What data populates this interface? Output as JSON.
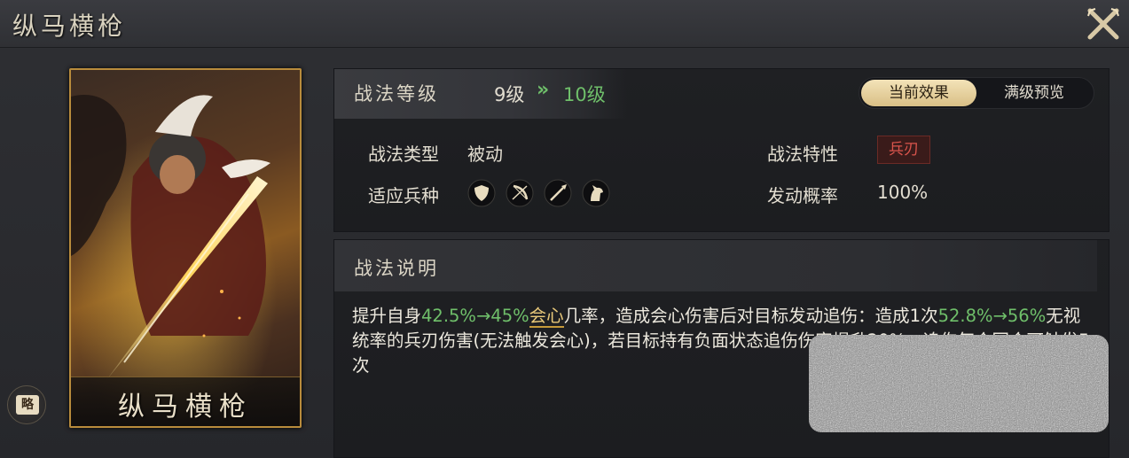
{
  "header": {
    "title": "纵马横枪"
  },
  "card": {
    "name": "纵马横枪",
    "strategy_badge": "略"
  },
  "level": {
    "label": "战法等级",
    "current": "9级",
    "arrow": "»",
    "next": "10级"
  },
  "view_toggle": {
    "current_label": "当前效果",
    "max_label": "满级预览",
    "selected": "当前效果"
  },
  "attributes": {
    "type_label": "战法类型",
    "type_value": "被动",
    "troops_label": "适应兵种",
    "troops": [
      "shield-icon",
      "bow-icon",
      "spear-icon",
      "horse-icon"
    ],
    "trait_label": "战法特性",
    "trait_value": "兵刃",
    "chance_label": "发动概率",
    "chance_value": "100%"
  },
  "description": {
    "title": "战法说明",
    "p1": "提升自身",
    "v1": "42.5%→45%",
    "k1": "会心",
    "p2": "几率，造成会心伤害后对目标发动追伤：造成1次",
    "v2": "52.8%→56%",
    "p3": "无视统率的兵刃伤害(无法触发会心)，若目标持有负面状态追伤伤害提升20%，追伤每个回合可触发5次"
  },
  "colors": {
    "accent_gold": "#c59a3a",
    "upgrade_green": "#6fbf6a",
    "blade_red": "#d9544c"
  }
}
